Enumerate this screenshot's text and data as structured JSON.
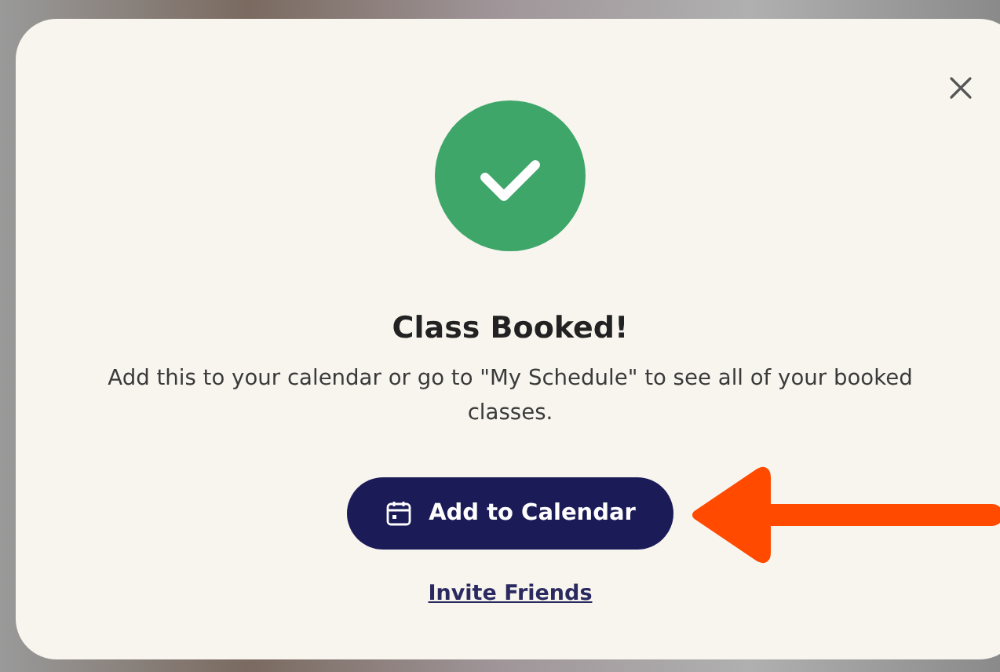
{
  "dialog": {
    "title": "Class Booked!",
    "message": "Add this to your calendar or go to \"My Schedule\" to see all of your booked classes.",
    "primary_button": {
      "label": "Add to Calendar"
    },
    "link": {
      "label": "Invite Friends"
    }
  }
}
